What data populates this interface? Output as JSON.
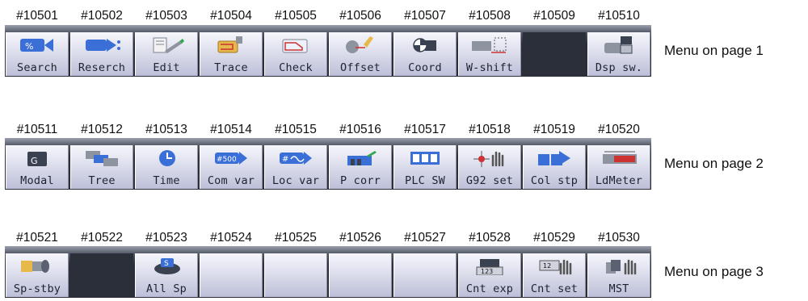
{
  "colors": {
    "bar_dark": "#2b2f3a",
    "key_light": "#e3e4f0",
    "key_shade": "#bcbfd8",
    "icon_blue": "#3a6fd8",
    "icon_gray": "#8e949f",
    "icon_red": "#cc3333",
    "icon_green": "#2fa84f"
  },
  "page1": {
    "caption": "Menu on page 1",
    "ids": [
      "#10501",
      "#10502",
      "#10503",
      "#10504",
      "#10505",
      "#10506",
      "#10507",
      "#10508",
      "#10509",
      "#10510"
    ],
    "keys": [
      {
        "label": "Search",
        "icon": "search-arrow-icon"
      },
      {
        "label": "Reserch",
        "icon": "research-arrow-icon"
      },
      {
        "label": "Edit",
        "icon": "edit-pencil-icon"
      },
      {
        "label": "Trace",
        "icon": "trace-tool-icon"
      },
      {
        "label": "Check",
        "icon": "check-path-icon"
      },
      {
        "label": "Offset",
        "icon": "offset-tool-icon"
      },
      {
        "label": "Coord",
        "icon": "coordinate-icon"
      },
      {
        "label": "W-shift",
        "icon": "work-shift-icon"
      },
      {
        "label": "",
        "icon": ""
      },
      {
        "label": "Dsp sw.",
        "icon": "display-switch-icon"
      }
    ]
  },
  "page2": {
    "caption": "Menu on page 2",
    "ids": [
      "#10511",
      "#10512",
      "#10513",
      "#10514",
      "#10515",
      "#10516",
      "#10517",
      "#10518",
      "#10519",
      "#10520"
    ],
    "keys": [
      {
        "label": "Modal",
        "icon": "modal-g-icon"
      },
      {
        "label": "Tree",
        "icon": "tree-windows-icon"
      },
      {
        "label": "Time",
        "icon": "clock-icon",
        "badge": ""
      },
      {
        "label": "Com var",
        "icon": "common-variable-icon",
        "badge": "#500"
      },
      {
        "label": "Loc var",
        "icon": "local-variable-icon",
        "badge": "#"
      },
      {
        "label": "P corr",
        "icon": "parameter-correction-icon"
      },
      {
        "label": "PLC SW",
        "icon": "plc-switch-icon"
      },
      {
        "label": "G92 set",
        "icon": "g92-hand-icon"
      },
      {
        "label": "Col stp",
        "icon": "collation-stop-icon"
      },
      {
        "label": "LdMeter",
        "icon": "load-meter-icon"
      }
    ]
  },
  "page3": {
    "caption": "Menu on page 3",
    "ids": [
      "#10521",
      "#10522",
      "#10523",
      "#10524",
      "#10525",
      "#10526",
      "#10527",
      "#10528",
      "#10529",
      "#10530"
    ],
    "keys": [
      {
        "label": "Sp-stby",
        "icon": "spindle-standby-icon"
      },
      {
        "label": "",
        "icon": ""
      },
      {
        "label": "All Sp",
        "icon": "all-spindle-icon",
        "badge": "S"
      },
      {
        "label": "",
        "icon": ""
      },
      {
        "label": "",
        "icon": ""
      },
      {
        "label": "",
        "icon": ""
      },
      {
        "label": "",
        "icon": ""
      },
      {
        "label": "Cnt exp",
        "icon": "counter-expand-icon",
        "badge": "123"
      },
      {
        "label": "Cnt set",
        "icon": "counter-set-icon",
        "badge": "12"
      },
      {
        "label": "MST",
        "icon": "mst-hand-icon"
      }
    ]
  }
}
